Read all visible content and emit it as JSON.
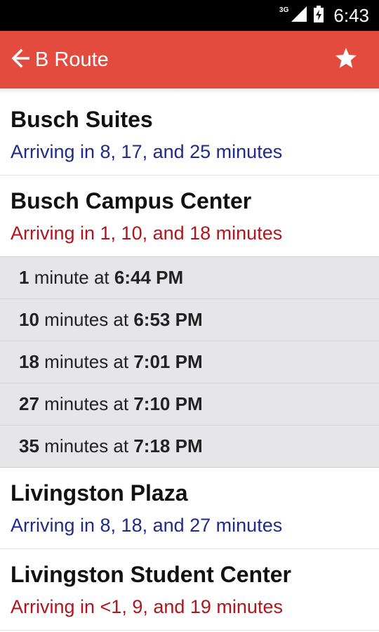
{
  "status_bar": {
    "network": "3G",
    "time": "6:43"
  },
  "app_bar": {
    "title": "B Route"
  },
  "stops": [
    {
      "name": "Busch Suites",
      "arrival": "Arriving in 8, 17, and 25 minutes",
      "arrival_color": "#1f2a8a"
    },
    {
      "name": "Busch Campus Center",
      "arrival": "Arriving in 1, 10, and 18 minutes",
      "arrival_color": "#b3141b"
    },
    {
      "name": "Livingston Plaza",
      "arrival": "Arriving in 8, 18, and 27 minutes",
      "arrival_color": "#1f2a8a"
    },
    {
      "name": "Livingston Student Center",
      "arrival": "Arriving in <1, 9, and 19 minutes",
      "arrival_color": "#b3141b"
    }
  ],
  "expanded_times": [
    {
      "minutes": "1",
      "unit": "minute at",
      "time": "6:44 PM"
    },
    {
      "minutes": "10",
      "unit": "minutes at",
      "time": "6:53 PM"
    },
    {
      "minutes": "18",
      "unit": "minutes at",
      "time": "7:01 PM"
    },
    {
      "minutes": "27",
      "unit": "minutes at",
      "time": "7:10 PM"
    },
    {
      "minutes": "35",
      "unit": "minutes at",
      "time": "7:18 PM"
    }
  ],
  "colors": {
    "app_bar": "#e24b3e",
    "status_bar": "#000000",
    "detail_bg": "#e6e5e8"
  }
}
